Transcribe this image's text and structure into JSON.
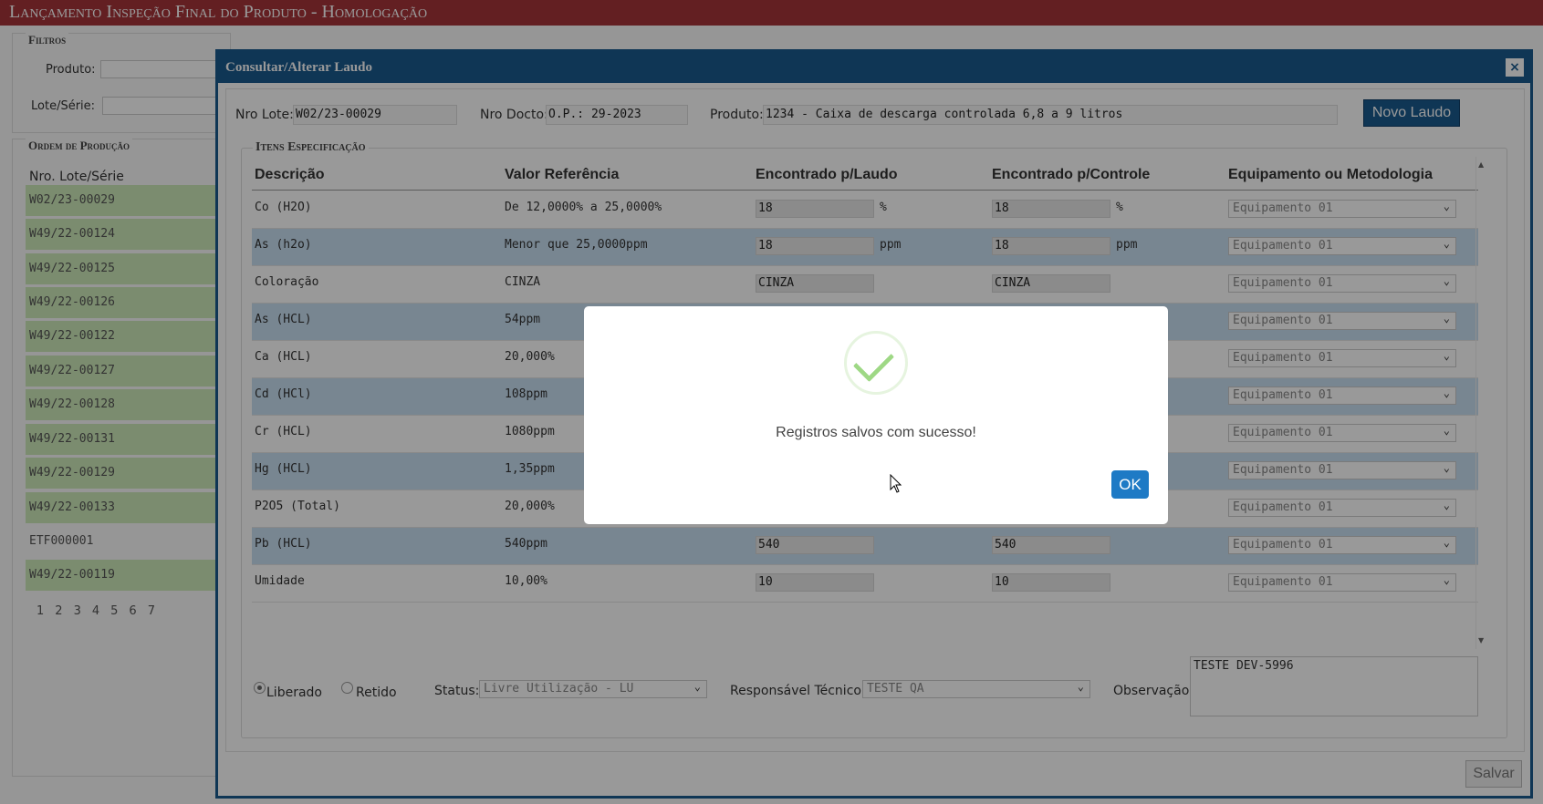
{
  "page": {
    "title": "Lançamento Inspeção Final do Produto  - Homologação"
  },
  "filters": {
    "legend": "Filtros",
    "produto_label": "Produto:",
    "lote_label": "Lote/Série:"
  },
  "orders": {
    "legend": "Ordem de Produção",
    "column": "Nro. Lote/Série",
    "rows": [
      "W02/23-00029",
      "W49/22-00124",
      "W49/22-00125",
      "W49/22-00126",
      "W49/22-00122",
      "W49/22-00127",
      "W49/22-00128",
      "W49/22-00131",
      "W49/22-00129",
      "W49/22-00133",
      "ETF000001",
      "W49/22-00119"
    ],
    "pages": [
      "1",
      "2",
      "3",
      "4",
      "5",
      "6",
      "7"
    ]
  },
  "dialog": {
    "title": "Consultar/Alterar Laudo",
    "close": "×",
    "nro_lote_label": "Nro Lote:",
    "nro_lote_value": "W02/23-00029",
    "nro_docto_label": "Nro Docto:",
    "nro_docto_value": "O.P.: 29-2023",
    "produto_label": "Produto:",
    "produto_value": "1234 - Caixa de descarga controlada 6,8 a 9 litros",
    "novo_laudo": "Novo Laudo",
    "section_legend": "Itens Especificação",
    "columns": [
      "Descrição",
      "Valor Referência",
      "Encontrado p/Laudo",
      "Encontrado p/Controle",
      "Equipamento ou Metodologia"
    ],
    "rows": [
      {
        "descricao": "Co (H2O)",
        "referencia": "De 12,0000% a 25,0000%",
        "laudo": "18",
        "laudo_unit": "%",
        "controle": "18",
        "controle_unit": "%",
        "equipamento": "Equipamento 01"
      },
      {
        "descricao": "As (h2o)",
        "referencia": "Menor que 25,0000ppm",
        "laudo": "18",
        "laudo_unit": "ppm",
        "controle": "18",
        "controle_unit": "ppm",
        "equipamento": "Equipamento 01"
      },
      {
        "descricao": "Coloração",
        "referencia": "CINZA",
        "laudo": "CINZA",
        "laudo_unit": "",
        "controle": "CINZA",
        "controle_unit": "",
        "equipamento": "Equipamento 01"
      },
      {
        "descricao": "As (HCL)",
        "referencia": "54ppm",
        "laudo": "",
        "laudo_unit": "",
        "controle": "",
        "controle_unit": "",
        "equipamento": "Equipamento 01"
      },
      {
        "descricao": "Ca (HCL)",
        "referencia": "20,000%",
        "laudo": "",
        "laudo_unit": "",
        "controle": "",
        "controle_unit": "",
        "equipamento": "Equipamento 01"
      },
      {
        "descricao": "Cd (HCl)",
        "referencia": "108ppm",
        "laudo": "",
        "laudo_unit": "",
        "controle": "",
        "controle_unit": "",
        "equipamento": "Equipamento 01"
      },
      {
        "descricao": "Cr (HCL)",
        "referencia": "1080ppm",
        "laudo": "",
        "laudo_unit": "",
        "controle": "",
        "controle_unit": "",
        "equipamento": "Equipamento 01"
      },
      {
        "descricao": "Hg (HCL)",
        "referencia": "1,35ppm",
        "laudo": "",
        "laudo_unit": "",
        "controle": "",
        "controle_unit": "",
        "equipamento": "Equipamento 01"
      },
      {
        "descricao": "P2O5 (Total)",
        "referencia": "20,000%",
        "laudo": "",
        "laudo_unit": "",
        "controle": "",
        "controle_unit": "",
        "equipamento": "Equipamento 01"
      },
      {
        "descricao": "Pb (HCL)",
        "referencia": "540ppm",
        "laudo": "540",
        "laudo_unit": "",
        "controle": "540",
        "controle_unit": "",
        "equipamento": "Equipamento 01"
      },
      {
        "descricao": "Umidade",
        "referencia": "10,00%",
        "laudo": "10",
        "laudo_unit": "",
        "controle": "10",
        "controle_unit": "",
        "equipamento": "Equipamento 01"
      }
    ],
    "liberado_label": "Liberado",
    "retido_label": "Retido",
    "status_label": "Status:",
    "status_value": "Livre Utilização - LU",
    "responsavel_label": "Responsável Técnico:",
    "responsavel_value": "TESTE QA",
    "observacao_label": "Observação:",
    "observacao_value": "TESTE DEV-5996",
    "salvar": "Salvar"
  },
  "alert": {
    "icon": "success-check-icon",
    "message": "Registros salvos com sucesso!",
    "ok": "OK"
  },
  "colors": {
    "header_bg": "#a5353a",
    "dialog_blue": "#1a5a8e",
    "row_alt": "#c9dff2",
    "ok_button": "#1e7ac5",
    "check": "#9ed885"
  }
}
